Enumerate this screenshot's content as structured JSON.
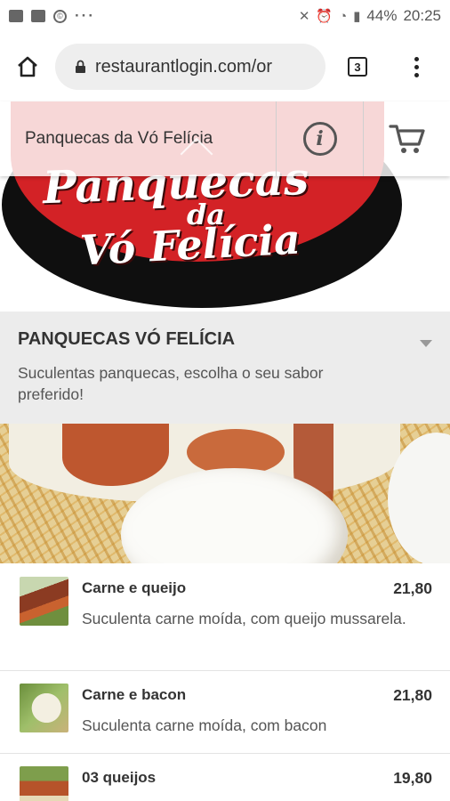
{
  "status_bar": {
    "battery": "44%",
    "time": "20:25"
  },
  "browser": {
    "url": "restaurantlogin.com/or",
    "tab_count": "3"
  },
  "header": {
    "title": "Panquecas da Vó Felícia"
  },
  "logo": {
    "line1": "Panquecas",
    "line2": "da",
    "line3": "Vó Felícia"
  },
  "category": {
    "title": "PANQUECAS VÓ FELÍCIA",
    "description": "Suculentas panquecas, escolha o seu sabor preferido!"
  },
  "items": [
    {
      "name": "Carne e queijo",
      "price": "21,80",
      "description": "Suculenta carne moída, com queijo mussarela."
    },
    {
      "name": "Carne e bacon",
      "price": "21,80",
      "description": "Suculenta carne moída, com bacon"
    },
    {
      "name": "03 queijos",
      "price": "19,80",
      "description": ""
    }
  ],
  "colors": {
    "brand_red": "#d32226",
    "category_bg": "#ececec"
  }
}
